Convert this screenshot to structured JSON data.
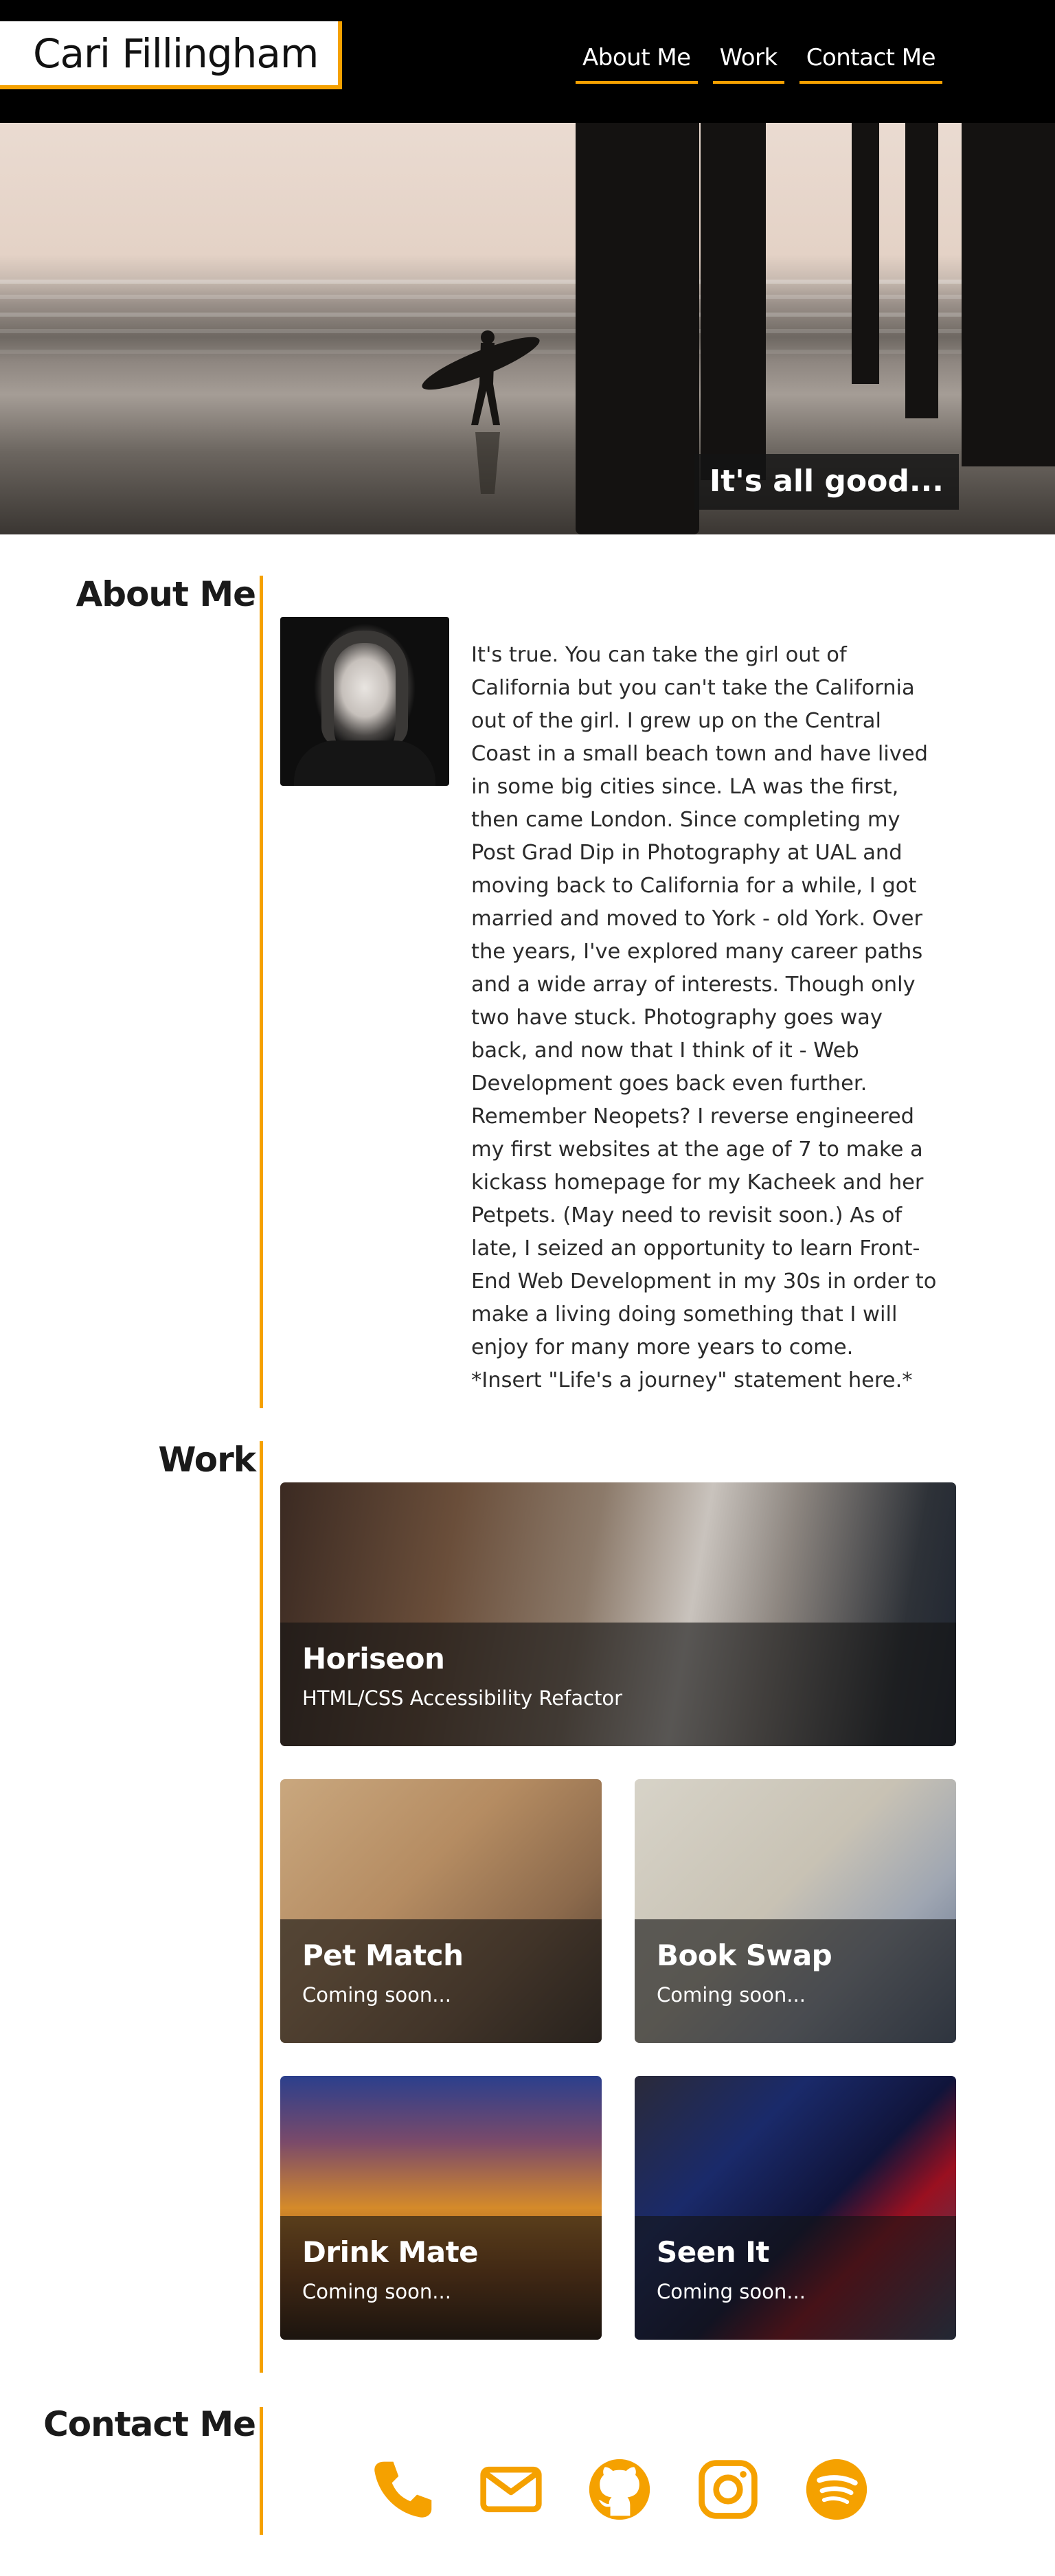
{
  "header": {
    "brand": "Cari Fillingham",
    "nav": [
      "About Me",
      "Work",
      "Contact Me"
    ]
  },
  "hero": {
    "caption": "It's all good..."
  },
  "about": {
    "heading": "About Me",
    "text": "It's true. You can take the girl out of California but you can't take the California out of the girl. I grew up on the Central Coast in a small beach town and have lived in some big cities since. LA was the first, then came London. Since completing my Post Grad Dip in Photography at UAL and moving back to California for a while, I got married and moved to York - old York. Over the years, I've explored many career paths and a wide array of interests. Though only two have stuck. Photography goes way back, and now that I think of it - Web Development goes back even further. Remember Neopets? I reverse engineered my first websites at the age of 7 to make a kickass homepage for my Kacheek and her Petpets. (May need to revisit soon.) As of late, I seized an opportunity to learn Front-End Web Development in my 30s in order to make a living doing something that I will enjoy for many more years to come.",
    "footnote": "*Insert \"Life's a journey\" statement here.*"
  },
  "work": {
    "heading": "Work",
    "projects": [
      {
        "title": "Horiseon",
        "subtitle": "HTML/CSS Accessibility Refactor"
      },
      {
        "title": "Pet Match",
        "subtitle": "Coming soon..."
      },
      {
        "title": "Book Swap",
        "subtitle": "Coming soon..."
      },
      {
        "title": "Drink Mate",
        "subtitle": "Coming soon..."
      },
      {
        "title": "Seen It",
        "subtitle": "Coming soon..."
      }
    ]
  },
  "contact": {
    "heading": "Contact Me",
    "icons": [
      "phone-icon",
      "email-icon",
      "github-icon",
      "instagram-icon",
      "spotify-icon"
    ]
  },
  "colors": {
    "accent": "#f5a100",
    "header_bg": "#000000",
    "overlay": "rgba(20,20,20,0.62)"
  }
}
